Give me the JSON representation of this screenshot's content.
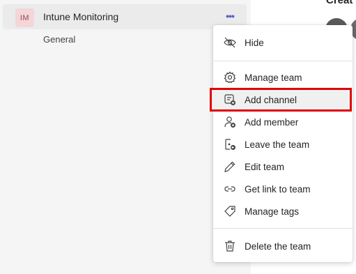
{
  "team": {
    "avatar_initials": "IM",
    "name": "Intune Monitoring",
    "more_label": "•••",
    "channels": [
      "General"
    ]
  },
  "right_pane": {
    "title_partial": "Creat"
  },
  "menu": {
    "items": [
      {
        "label": "Hide",
        "icon": "hide-icon"
      },
      {
        "label": "Manage team",
        "icon": "gear-icon"
      },
      {
        "label": "Add channel",
        "icon": "add-channel-icon",
        "highlighted": true
      },
      {
        "label": "Add member",
        "icon": "add-member-icon"
      },
      {
        "label": "Leave the team",
        "icon": "leave-team-icon"
      },
      {
        "label": "Edit team",
        "icon": "pencil-icon"
      },
      {
        "label": "Get link to team",
        "icon": "link-icon"
      },
      {
        "label": "Manage tags",
        "icon": "tag-icon"
      },
      {
        "label": "Delete the team",
        "icon": "trash-icon"
      }
    ]
  },
  "colors": {
    "accent": "#5b5fc7",
    "highlight_border": "#e00000",
    "avatar_bg": "#f4d6d8"
  }
}
